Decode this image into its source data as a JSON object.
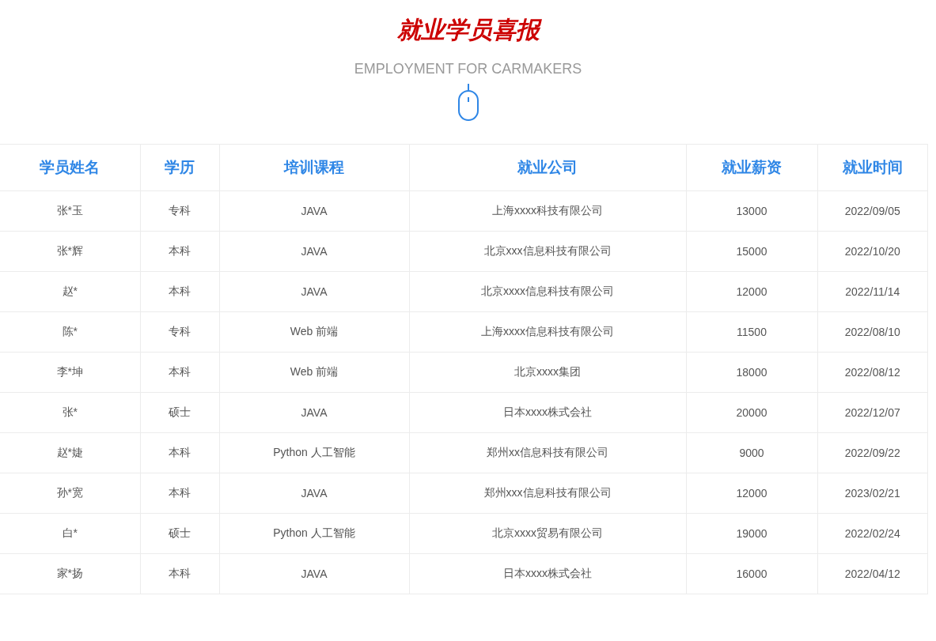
{
  "title": "就业学员喜报",
  "subtitle": "EMPLOYMENT FOR CARMAKERS",
  "table": {
    "columns": [
      "学员姓名",
      "学历",
      "培训课程",
      "就业公司",
      "就业薪资",
      "就业时间"
    ],
    "rows": [
      [
        "张*玉",
        "专科",
        "JAVA",
        "上海xxxx科技有限公司",
        "13000",
        "2022/09/05"
      ],
      [
        "张*辉",
        "本科",
        "JAVA",
        "北京xxx信息科技有限公司",
        "15000",
        "2022/10/20"
      ],
      [
        "赵*",
        "本科",
        "JAVA",
        "北京xxxx信息科技有限公司",
        "12000",
        "2022/11/14"
      ],
      [
        "陈*",
        "专科",
        "Web 前端",
        "上海xxxx信息科技有限公司",
        "11500",
        "2022/08/10"
      ],
      [
        "李*坤",
        "本科",
        "Web 前端",
        "北京xxxx集团",
        "18000",
        "2022/08/12"
      ],
      [
        "张*",
        "硕士",
        "JAVA",
        "日本xxxx株式会社",
        "20000",
        "2022/12/07"
      ],
      [
        "赵*婕",
        "本科",
        "Python 人工智能",
        "郑州xx信息科技有限公司",
        "9000",
        "2022/09/22"
      ],
      [
        "孙*宽",
        "本科",
        "JAVA",
        "郑州xxx信息科技有限公司",
        "12000",
        "2023/02/21"
      ],
      [
        "白*",
        "硕士",
        "Python 人工智能",
        "北京xxxx贸易有限公司",
        "19000",
        "2022/02/24"
      ],
      [
        "家*扬",
        "本科",
        "JAVA",
        "日本xxxx株式会社",
        "16000",
        "2022/04/12"
      ]
    ]
  }
}
